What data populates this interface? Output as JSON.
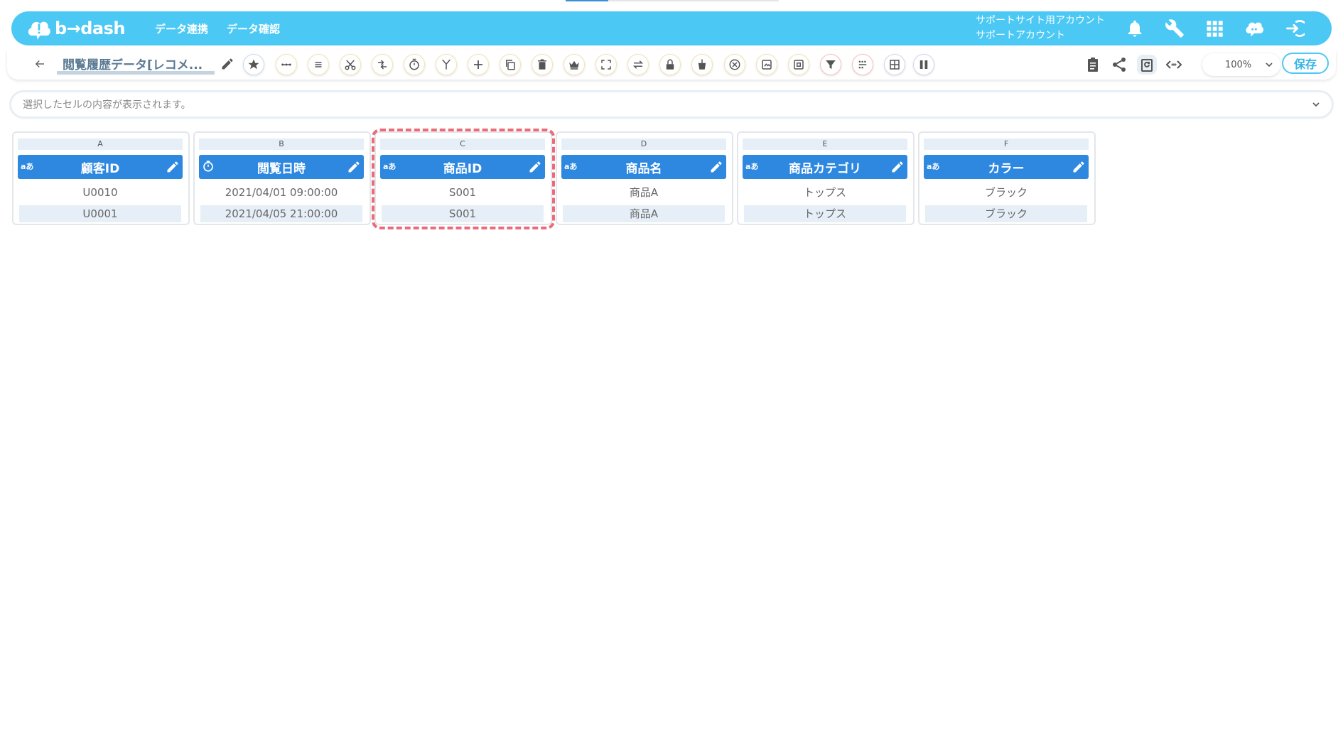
{
  "brand": {
    "logo_text": "b→dash"
  },
  "nav": [
    "データ連携",
    "データ確認"
  ],
  "account": {
    "line1": "サポートサイト用アカウント",
    "line2": "サポートアカウント"
  },
  "header_icons": [
    "bell-icon",
    "wrench-icon",
    "grid-icon",
    "chat-icon",
    "logout-icon"
  ],
  "toolbar": {
    "sheet_title": "閲覧履歴データ[レコメ...",
    "zoom": "100%",
    "save_label": "保存",
    "tools": [
      "star-icon",
      "dots-icon",
      "list-icon",
      "cut-icon",
      "transform-icon",
      "timer-icon",
      "merge-icon",
      "plus-icon",
      "copy-icon",
      "trash-icon",
      "crown-icon",
      "expand-icon",
      "swap-icon",
      "lock-icon",
      "bucket-icon",
      "close-circle-icon",
      "image-icon",
      "frame-icon",
      "filter-icon",
      "group-icon",
      "table-icon",
      "columns-icon"
    ]
  },
  "cell_bar": {
    "placeholder": "選択したセルの内容が表示されます。"
  },
  "columns": [
    {
      "letter": "A",
      "name": "顧客ID",
      "type": "aあ",
      "row1": "U0010",
      "row2": "U0001"
    },
    {
      "letter": "B",
      "name": "閲覧日時",
      "type": "clock",
      "row1": "2021/04/01 09:00:00",
      "row2": "2021/04/05 21:00:00"
    },
    {
      "letter": "C",
      "name": "商品ID",
      "type": "aあ",
      "row1": "S001",
      "row2": "S001"
    },
    {
      "letter": "D",
      "name": "商品名",
      "type": "aあ",
      "row1": "商品A",
      "row2": "商品A"
    },
    {
      "letter": "E",
      "name": "商品カテゴリ",
      "type": "aあ",
      "row1": "トップス",
      "row2": "トップス"
    },
    {
      "letter": "F",
      "name": "カラー",
      "type": "aあ",
      "row1": "ブラック",
      "row2": "ブラック"
    }
  ],
  "colors": {
    "header": "#4cc8f4",
    "column_header": "#2e88e0",
    "selection": "#ec6a79"
  }
}
